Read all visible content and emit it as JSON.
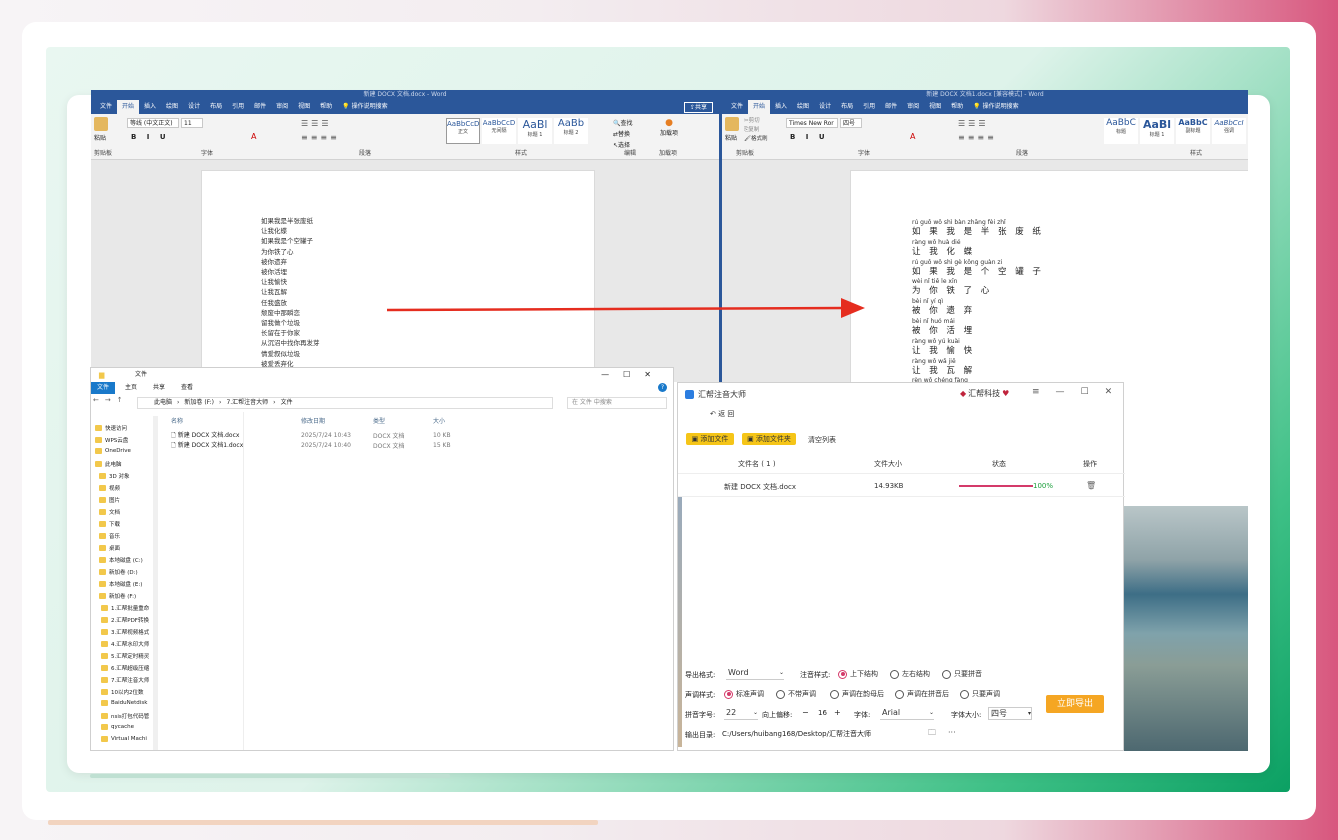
{
  "word_left": {
    "title": "新建 DOCX 文档.docx - Word",
    "tabs": [
      "文件",
      "开始",
      "插入",
      "绘图",
      "设计",
      "布局",
      "引用",
      "邮件",
      "审阅",
      "视图",
      "帮助",
      "操作说明搜索"
    ],
    "share": "共享",
    "font": "等线 (中文正文)",
    "size": "11",
    "styles": [
      {
        "preview": "AaBbCcD",
        "name": "正文"
      },
      {
        "preview": "AaBbCcD",
        "name": "无间隔"
      },
      {
        "preview": "AaBl",
        "name": "标题 1"
      },
      {
        "preview": "AaBb",
        "name": "标题 2"
      }
    ],
    "groups": [
      "剪贴板",
      "字体",
      "段落",
      "样式",
      "编辑",
      "加载项"
    ],
    "paste": "粘贴",
    "find": "查找",
    "replace": "替换",
    "select": "选择",
    "addin": "加载项",
    "lines": [
      "如果我是半张废纸",
      "让我化蝶",
      "如果我是个空罐子",
      "为你铁了心",
      "被你遗弃",
      "被你活埋",
      "让我愉快",
      "让我瓦解",
      "任我盛放",
      "颓废中那瞬恋",
      "留我做个垃圾",
      "长留在于你家",
      "从沉沼中找你再发芽",
      "情爱叙似垃圾",
      "被爱丢弃化"
    ]
  },
  "word_right": {
    "title": "新建 DOCX 文档1.docx [兼容模式] - Word",
    "tabs": [
      "文件",
      "开始",
      "插入",
      "绘图",
      "设计",
      "布局",
      "引用",
      "邮件",
      "审阅",
      "视图",
      "帮助",
      "操作说明搜索"
    ],
    "font": "Times New Ror",
    "size": "四号",
    "styles": [
      {
        "preview": "AaBbC",
        "name": "标题"
      },
      {
        "preview": "AaBl",
        "name": "标题 1"
      },
      {
        "preview": "AaBbC",
        "name": "副标题"
      },
      {
        "preview": "AaBbCcI",
        "name": "强调"
      }
    ],
    "groups": [
      "剪贴板",
      "字体",
      "段落",
      "样式"
    ],
    "paste": "粘贴",
    "cut": "剪切",
    "copy": "复制",
    "painter": "格式刷",
    "pairs": [
      {
        "py": "rú guǒ wǒ shì bàn zhāng fèi zhǐ",
        "hz": "如 果 我 是 半 张 废 纸"
      },
      {
        "py": "ràng wǒ huà dié",
        "hz": "让 我 化 蝶"
      },
      {
        "py": "rú guǒ wǒ shì gè kōng guàn zi",
        "hz": "如 果 我 是 个 空 罐 子"
      },
      {
        "py": "wèi nǐ tiě le xīn",
        "hz": "为 你 铁 了 心"
      },
      {
        "py": "bèi nǐ yí qì",
        "hz": "被 你 遗 弃"
      },
      {
        "py": "bèi nǐ huó mái",
        "hz": "被 你 活 埋"
      },
      {
        "py": "ràng wǒ yú kuài",
        "hz": "让 我 愉 快"
      },
      {
        "py": "ràng wǒ wǎ jiě",
        "hz": "让 我 瓦 解"
      },
      {
        "py": "rèn wǒ chéng fàng",
        "hz": ""
      }
    ]
  },
  "explorer": {
    "title": "文件",
    "tabs": [
      "文件",
      "主页",
      "共享",
      "查看"
    ],
    "path": [
      "此电脑",
      "新加卷 (F:)",
      "7.汇帮注音大师",
      "文件"
    ],
    "search_placeholder": "在 文件 中搜索",
    "columns": [
      "名称",
      "修改日期",
      "类型",
      "大小"
    ],
    "files": [
      {
        "name": "新建 DOCX 文档.docx",
        "date": "2025/7/24 10:43",
        "type": "DOCX 文档",
        "size": "10 KB"
      },
      {
        "name": "新建 DOCX 文档1.docx",
        "date": "2025/7/24 10:40",
        "type": "DOCX 文档",
        "size": "15 KB"
      }
    ],
    "nav": [
      "快速访问",
      "WPS云盘",
      "OneDrive",
      "此电脑",
      "3D 对象",
      "视频",
      "图片",
      "文档",
      "下载",
      "音乐",
      "桌面",
      "本地磁盘 (C:)",
      "新加卷 (D:)",
      "本地磁盘 (E:)",
      "新加卷 (F:)",
      "1.汇帮批量重命",
      "2.汇帮PDF转换",
      "3.汇帮视频格式",
      "4.汇帮水印大师",
      "5.汇帮定时精灵",
      "6.汇帮超级压缩",
      "7.汇帮注音大师",
      "10以内2位数",
      "BaiduNetdisk",
      "nsis打包代码管",
      "qycache",
      "Virtual Machi"
    ]
  },
  "app": {
    "title": "汇帮注音大师",
    "brand": "汇帮科技",
    "back": "返 回",
    "add_file": "添加文件",
    "add_folder": "添加文件夹",
    "clear": "清空列表",
    "columns": [
      "文件名 ( 1 )",
      "文件大小",
      "状态",
      "操作"
    ],
    "row": {
      "name": "新建 DOCX 文档.docx",
      "size": "14.93KB",
      "status": "100%"
    },
    "progress": 1.0,
    "export_format_label": "导出格式:",
    "export_format": "Word",
    "annot_label": "注音样式:",
    "annot_opts": [
      "上下结构",
      "左右结构",
      "只要拼音"
    ],
    "tone_label": "声调样式:",
    "tone_opts": [
      "标准声调",
      "不带声调",
      "声调在韵母后",
      "声调在拼音后",
      "只要声调"
    ],
    "size_label": "拼音字号:",
    "size_value": "22",
    "offset_label": "向上偏移:",
    "offset_minus": "−",
    "offset_value": "16",
    "offset_plus": "+",
    "font_label": "字体:",
    "font_value": "Arial",
    "fontsize_label": "字体大小:",
    "fontsize_value": "四号",
    "export_btn": "立即导出",
    "outdir_label": "输出目录:",
    "outdir_value": "C:/Users/huibang168/Desktop/汇帮注音大师",
    "more": "···",
    "accent": "#d43a6a"
  }
}
